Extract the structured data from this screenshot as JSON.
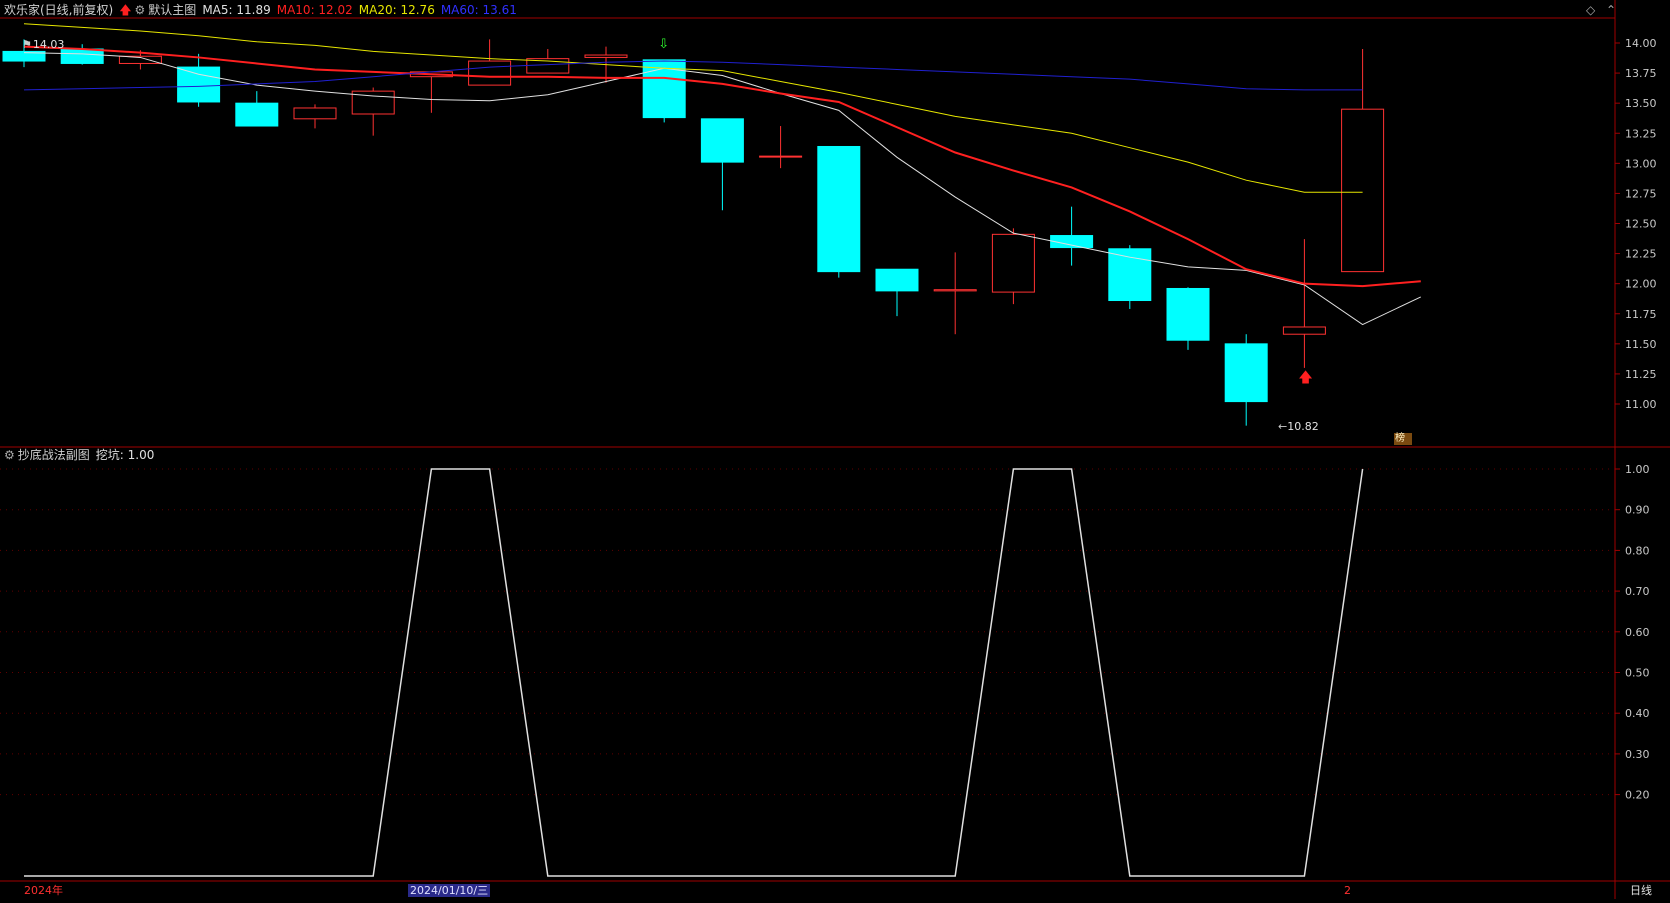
{
  "header": {
    "stock_name": "欢乐家(日线,前复权)",
    "template_name": "默认主图",
    "ma5_label": "MA5: 11.89",
    "ma10_label": "MA10: 12.02",
    "ma20_label": "MA20: 12.76",
    "ma60_label": "MA60: 13.61"
  },
  "sub_header": {
    "indicator_name": "抄底战法副图",
    "value_label": "挖坑: 1.00"
  },
  "annotations": {
    "high_label": "14.03",
    "low_label": "10.82",
    "badge": "榜"
  },
  "xaxis": {
    "year_label": "2024年",
    "date_label": "2024/01/10/三",
    "marker_label": "2",
    "period_label": "日线"
  },
  "colors": {
    "up": "#ff3232",
    "down": "#00ffff",
    "ma5": "#e0e0e0",
    "ma10": "#ff2020",
    "ma20": "#e6e600",
    "ma60": "#2020d0",
    "indicator": "#e0e0e0",
    "frame": "#a00000"
  },
  "chart_data": [
    {
      "type": "candlestick",
      "title": "欢乐家(日线,前复权)",
      "ylim": [
        10.7,
        14.1
      ],
      "yticks": [
        11.0,
        11.25,
        11.5,
        11.75,
        12.0,
        12.25,
        12.5,
        12.75,
        13.0,
        13.25,
        13.5,
        13.75,
        14.0
      ],
      "candles": [
        {
          "o": 13.93,
          "h": 14.03,
          "c": 13.85,
          "l": 13.8
        },
        {
          "o": 13.95,
          "h": 13.99,
          "c": 13.83,
          "l": 13.82
        },
        {
          "o": 13.83,
          "h": 13.94,
          "c": 13.89,
          "l": 13.78
        },
        {
          "o": 13.8,
          "h": 13.91,
          "c": 13.51,
          "l": 13.47
        },
        {
          "o": 13.5,
          "h": 13.6,
          "c": 13.31,
          "l": 13.31
        },
        {
          "o": 13.37,
          "h": 13.49,
          "c": 13.46,
          "l": 13.29
        },
        {
          "o": 13.41,
          "h": 13.63,
          "c": 13.6,
          "l": 13.23
        },
        {
          "o": 13.72,
          "h": 13.76,
          "c": 13.76,
          "l": 13.42
        },
        {
          "o": 13.65,
          "h": 14.03,
          "c": 13.85,
          "l": 13.65
        },
        {
          "o": 13.75,
          "h": 13.95,
          "c": 13.87,
          "l": 13.75
        },
        {
          "o": 13.88,
          "h": 13.97,
          "c": 13.9,
          "l": 13.67
        },
        {
          "o": 13.86,
          "h": 13.86,
          "c": 13.38,
          "l": 13.34
        },
        {
          "o": 13.37,
          "h": 13.37,
          "c": 13.01,
          "l": 12.61
        },
        {
          "o": 13.06,
          "h": 13.31,
          "c": 13.06,
          "l": 12.96
        },
        {
          "o": 13.14,
          "h": 13.14,
          "c": 12.1,
          "l": 12.05
        },
        {
          "o": 12.12,
          "h": 12.12,
          "c": 11.94,
          "l": 11.73
        },
        {
          "o": 11.94,
          "h": 12.26,
          "c": 11.95,
          "l": 11.58
        },
        {
          "o": 11.93,
          "h": 12.46,
          "c": 12.41,
          "l": 11.83
        },
        {
          "o": 12.4,
          "h": 12.64,
          "c": 12.3,
          "l": 12.15
        },
        {
          "o": 12.29,
          "h": 12.32,
          "c": 11.86,
          "l": 11.79
        },
        {
          "o": 11.96,
          "h": 11.97,
          "c": 11.53,
          "l": 11.45
        },
        {
          "o": 11.5,
          "h": 11.58,
          "c": 11.02,
          "l": 10.82
        },
        {
          "o": 11.58,
          "h": 12.37,
          "c": 11.64,
          "l": 11.3
        },
        {
          "o": 12.1,
          "h": 13.95,
          "c": 13.45,
          "l": 12.1
        }
      ],
      "ma_series": [
        {
          "name": "MA5",
          "values": [
            13.92,
            13.91,
            13.88,
            13.74,
            13.65,
            13.6,
            13.56,
            13.53,
            13.52,
            13.57,
            13.68,
            13.79,
            13.73,
            13.58,
            13.44,
            13.05,
            12.72,
            12.42,
            12.32,
            12.22,
            12.14,
            12.11,
            11.99,
            11.66,
            11.89
          ]
        },
        {
          "name": "MA10",
          "values": [
            13.97,
            13.95,
            13.92,
            13.88,
            13.83,
            13.78,
            13.76,
            13.74,
            13.72,
            13.72,
            13.71,
            13.71,
            13.66,
            13.58,
            13.51,
            13.3,
            13.09,
            12.94,
            12.8,
            12.6,
            12.37,
            12.12,
            12.0,
            11.98,
            12.02
          ]
        },
        {
          "name": "MA20",
          "values": [
            14.16,
            14.13,
            14.1,
            14.06,
            14.01,
            13.98,
            13.93,
            13.9,
            13.87,
            13.85,
            13.82,
            13.79,
            13.77,
            13.68,
            13.59,
            13.49,
            13.39,
            13.32,
            13.25,
            13.13,
            13.01,
            12.86,
            12.76,
            12.76
          ]
        },
        {
          "name": "MA60",
          "values": [
            13.61,
            13.62,
            13.63,
            13.64,
            13.66,
            13.68,
            13.72,
            13.76,
            13.8,
            13.82,
            13.84,
            13.85,
            13.84,
            13.82,
            13.8,
            13.78,
            13.76,
            13.74,
            13.72,
            13.7,
            13.66,
            13.62,
            13.61,
            13.61
          ]
        }
      ]
    },
    {
      "type": "line",
      "title": "抄底战法副图",
      "ylim": [
        0,
        1.0
      ],
      "yticks": [
        0.2,
        0.3,
        0.4,
        0.5,
        0.6,
        0.7,
        0.8,
        0.9,
        1.0
      ],
      "series": [
        {
          "name": "挖坑",
          "values": [
            0,
            0,
            0,
            0,
            0,
            0,
            0,
            1,
            1,
            0,
            0,
            0,
            0,
            0,
            0,
            0,
            0,
            1,
            1,
            0,
            0,
            0,
            0,
            1
          ]
        }
      ]
    }
  ]
}
